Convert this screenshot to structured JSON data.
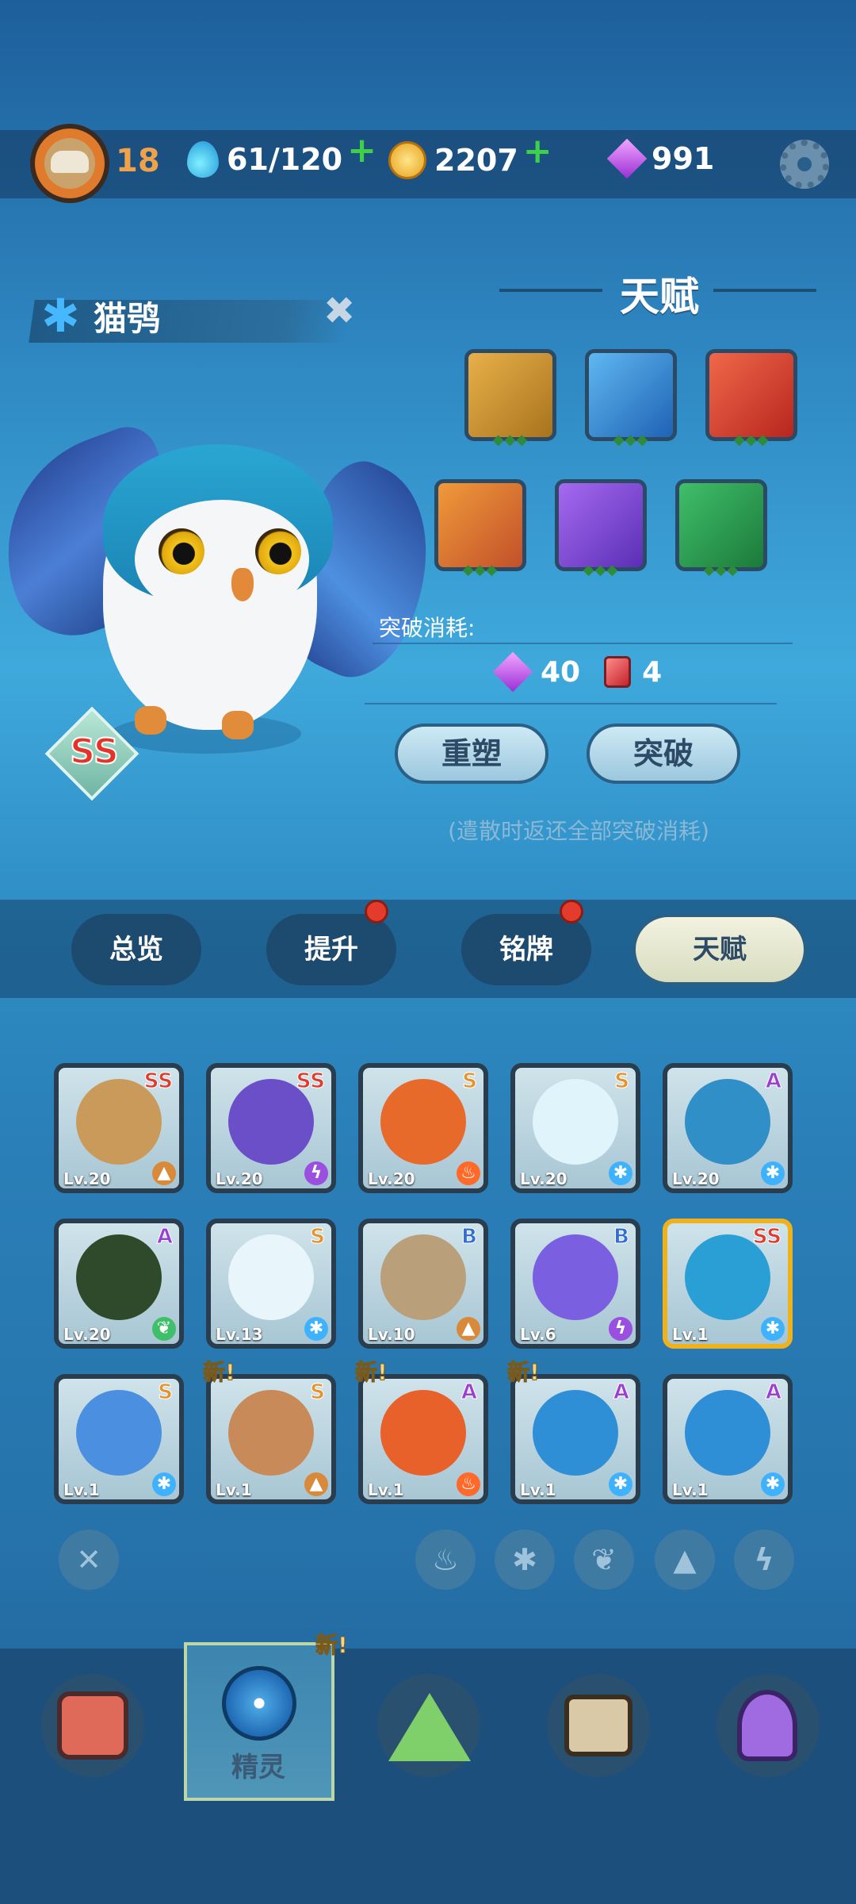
{
  "header": {
    "player_level": "18",
    "energy": "61/120",
    "coins": "2207",
    "gems": "991"
  },
  "creature": {
    "name": "猫鸮",
    "rank": "SS"
  },
  "talent": {
    "title": "天赋",
    "breakthrough_label": "突破消耗:",
    "gem_cost": "40",
    "card_cost": "4",
    "reshape_label": "重塑",
    "breakthrough_button": "突破",
    "note": "(遣散时返还全部突破消耗)"
  },
  "tabs": [
    {
      "label": "总览"
    },
    {
      "label": "提升"
    },
    {
      "label": "铭牌"
    },
    {
      "label": "天赋"
    }
  ],
  "roster": [
    {
      "level": "Lv.20",
      "grade": "SS",
      "grade_color": "#e03b2c",
      "element": "earth"
    },
    {
      "level": "Lv.20",
      "grade": "SS",
      "grade_color": "#e03b2c",
      "element": "lightning"
    },
    {
      "level": "Lv.20",
      "grade": "S",
      "grade_color": "#e6932c",
      "element": "fire"
    },
    {
      "level": "Lv.20",
      "grade": "S",
      "grade_color": "#e6932c",
      "element": "ice"
    },
    {
      "level": "Lv.20",
      "grade": "A",
      "grade_color": "#9a3fd6",
      "element": "ice"
    },
    {
      "level": "Lv.20",
      "grade": "A",
      "grade_color": "#9a3fd6",
      "element": "leaf"
    },
    {
      "level": "Lv.13",
      "grade": "S",
      "grade_color": "#e6932c",
      "element": "ice"
    },
    {
      "level": "Lv.10",
      "grade": "B",
      "grade_color": "#2f6fd6",
      "element": "earth"
    },
    {
      "level": "Lv.6",
      "grade": "B",
      "grade_color": "#2f6fd6",
      "element": "lightning"
    },
    {
      "level": "Lv.1",
      "grade": "SS",
      "grade_color": "#e03b2c",
      "element": "ice"
    },
    {
      "level": "Lv.1",
      "grade": "S",
      "grade_color": "#e6932c",
      "element": "ice"
    },
    {
      "level": "Lv.1",
      "grade": "S",
      "grade_color": "#e6932c",
      "element": "earth",
      "new": "新!"
    },
    {
      "level": "Lv.1",
      "grade": "A",
      "grade_color": "#9a3fd6",
      "element": "fire",
      "new": "新!"
    },
    {
      "level": "Lv.1",
      "grade": "A",
      "grade_color": "#9a3fd6",
      "element": "ice",
      "new": "新!"
    },
    {
      "level": "Lv.1",
      "grade": "A",
      "grade_color": "#9a3fd6",
      "element": "ice"
    }
  ],
  "bottom_nav": {
    "selected_label": "精灵",
    "new_badge": "新!"
  }
}
